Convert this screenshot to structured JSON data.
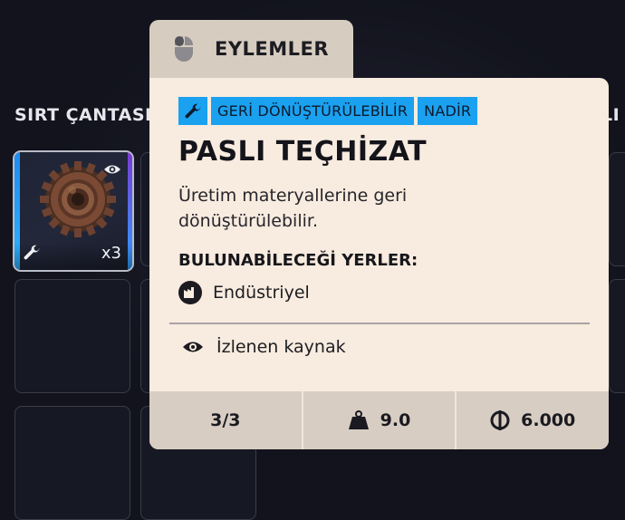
{
  "inventory": {
    "backpack_label": "SIRT ÇANTASI",
    "right_label": "LI",
    "item_slot": {
      "quantity": "x3",
      "rarity_color": "#1aa1f0"
    }
  },
  "tooltip": {
    "tab_label": "EYLEMLER",
    "tags": [
      "GERİ DÖNÜŞTÜRÜLEBİLİR",
      "NADİR"
    ],
    "title": "PASLI TEÇHİZAT",
    "description": "Üretim materyallerine geri dönüştürülebilir.",
    "found_label": "BULUNABİLECEĞİ YERLER:",
    "location": "Endüstriyel",
    "tracked": "İzlenen kaynak",
    "stats": {
      "stack": "3/3",
      "weight": "9.0",
      "price": "6.000"
    }
  },
  "colors": {
    "accent": "#1aa1f0",
    "card_bg": "#f8ebdf",
    "stats_bg": "#d8cdc3",
    "page_bg": "#12131d"
  },
  "icons": [
    "wrench-icon",
    "eye-icon",
    "mouse-icon",
    "factory-icon",
    "weight-icon",
    "coin-icon",
    "gear-item-image"
  ]
}
